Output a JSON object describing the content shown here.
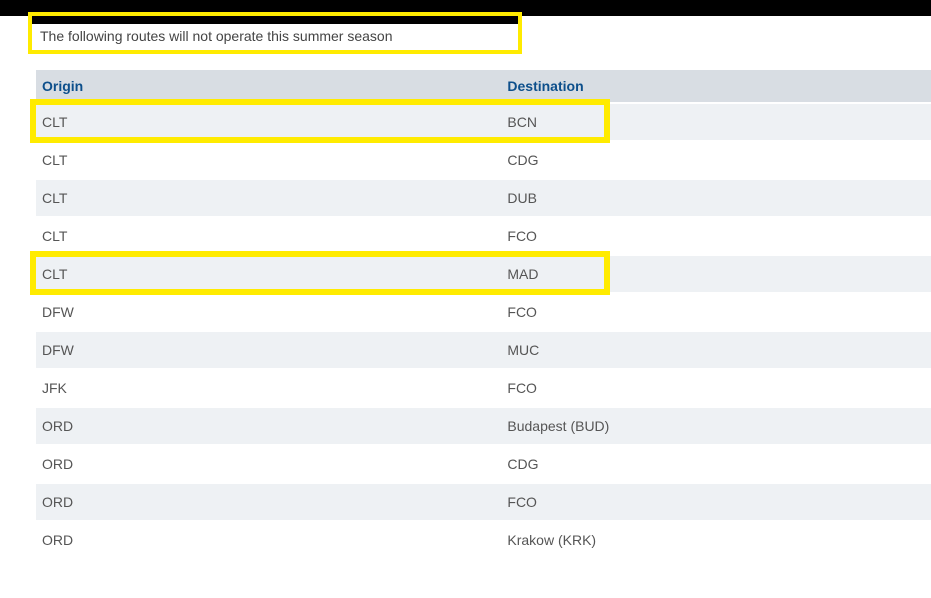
{
  "intro_text": "The following routes will not operate this summer season",
  "table": {
    "columns": {
      "origin": "Origin",
      "destination": "Destination"
    },
    "rows": [
      {
        "origin": "CLT",
        "destination": "BCN"
      },
      {
        "origin": "CLT",
        "destination": "CDG"
      },
      {
        "origin": "CLT",
        "destination": "DUB"
      },
      {
        "origin": "CLT",
        "destination": "FCO"
      },
      {
        "origin": "CLT",
        "destination": "MAD"
      },
      {
        "origin": "DFW",
        "destination": "FCO"
      },
      {
        "origin": "DFW",
        "destination": "MUC"
      },
      {
        "origin": "JFK",
        "destination": "FCO"
      },
      {
        "origin": "ORD",
        "destination": "Budapest (BUD)"
      },
      {
        "origin": "ORD",
        "destination": "CDG"
      },
      {
        "origin": "ORD",
        "destination": "FCO"
      },
      {
        "origin": "ORD",
        "destination": "Krakow (KRK)"
      }
    ]
  },
  "highlights": [
    {
      "row_index": 0
    },
    {
      "row_index": 4
    }
  ]
}
